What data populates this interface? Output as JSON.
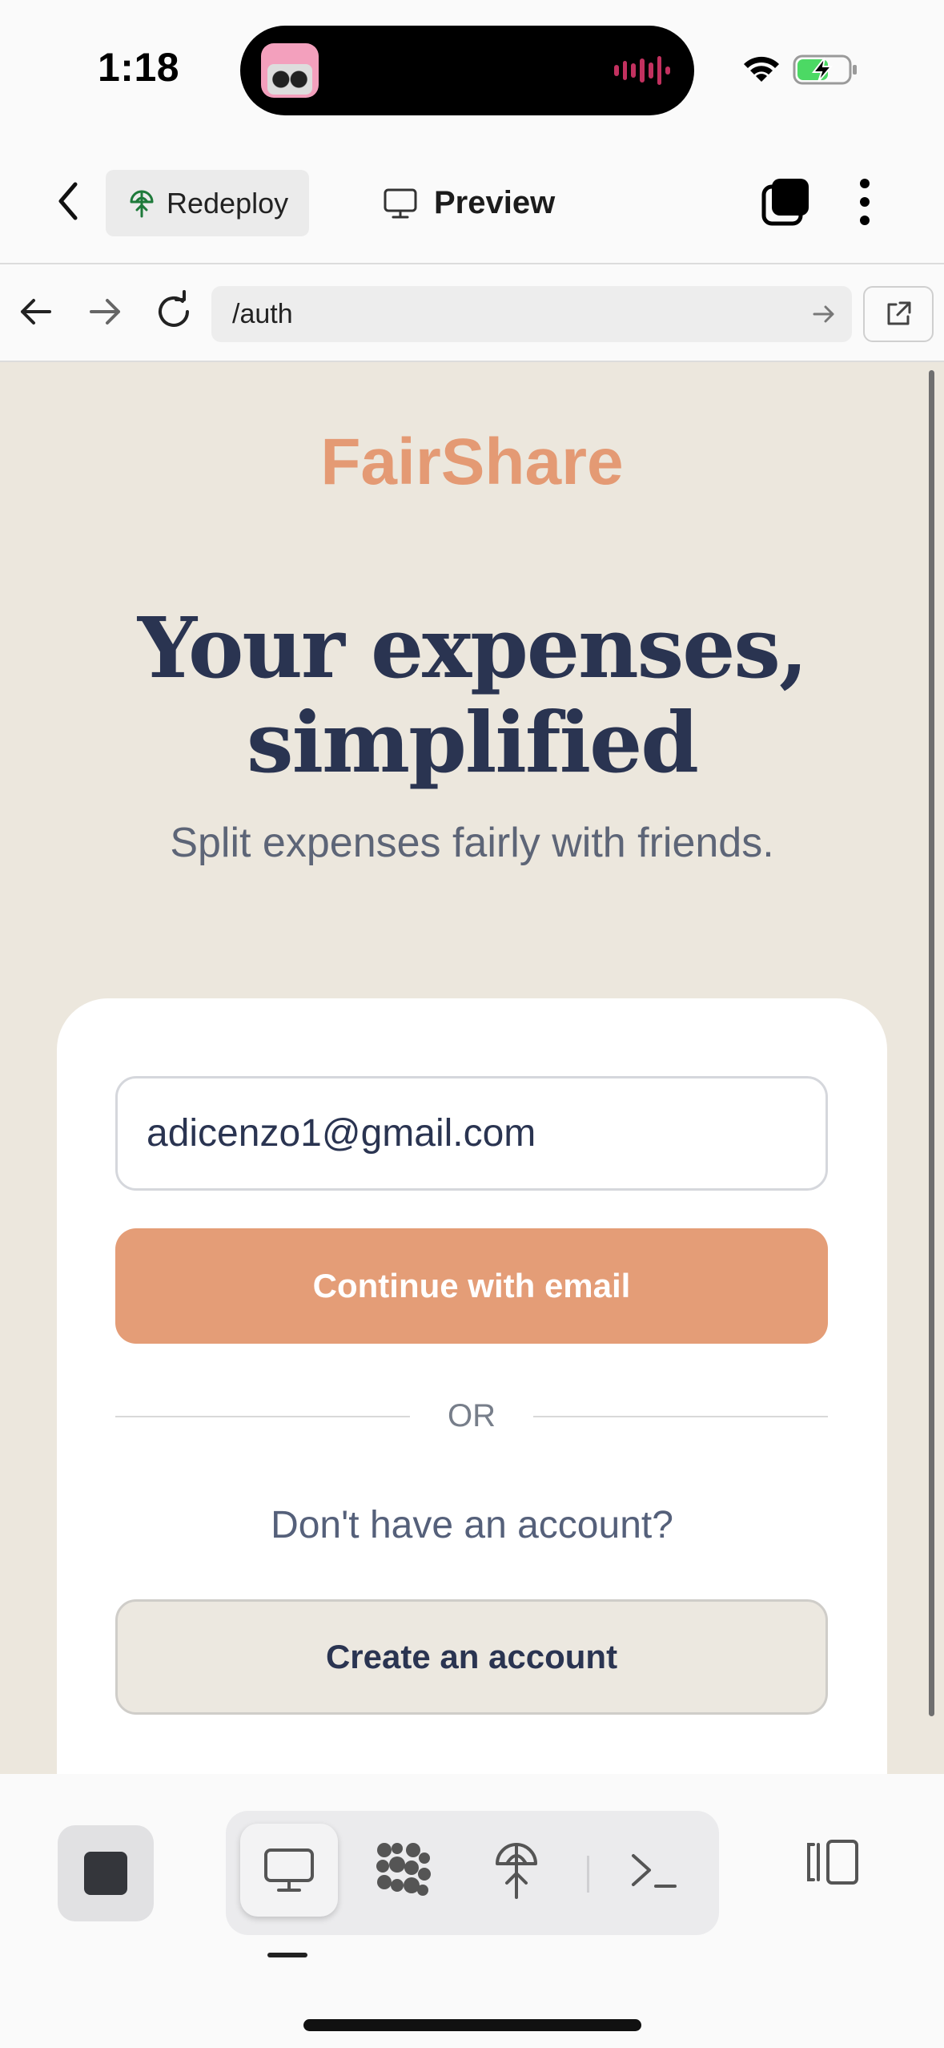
{
  "status_bar": {
    "time": "1:18"
  },
  "toolbar": {
    "redeploy_label": "Redeploy",
    "preview_label": "Preview"
  },
  "browser": {
    "url": "/auth"
  },
  "page": {
    "brand": "FairShare",
    "headline_line1": "Your expenses,",
    "headline_line2": "simplified",
    "subline": "Split expenses fairly with friends.",
    "email_value": "adicenzo1@gmail.com",
    "continue_label": "Continue with email",
    "or_label": "OR",
    "no_account_text": "Don't have an account?",
    "create_label": "Create an account"
  },
  "colors": {
    "brand": "#e49a74",
    "primary_button": "#e49d77",
    "headline": "#2a3451",
    "page_bg": "#ece7dd"
  },
  "dock": {
    "icons": [
      "stop-icon",
      "desktop-icon",
      "app-grid-icon",
      "deploy-icon",
      "terminal-icon",
      "split-view-icon"
    ]
  }
}
